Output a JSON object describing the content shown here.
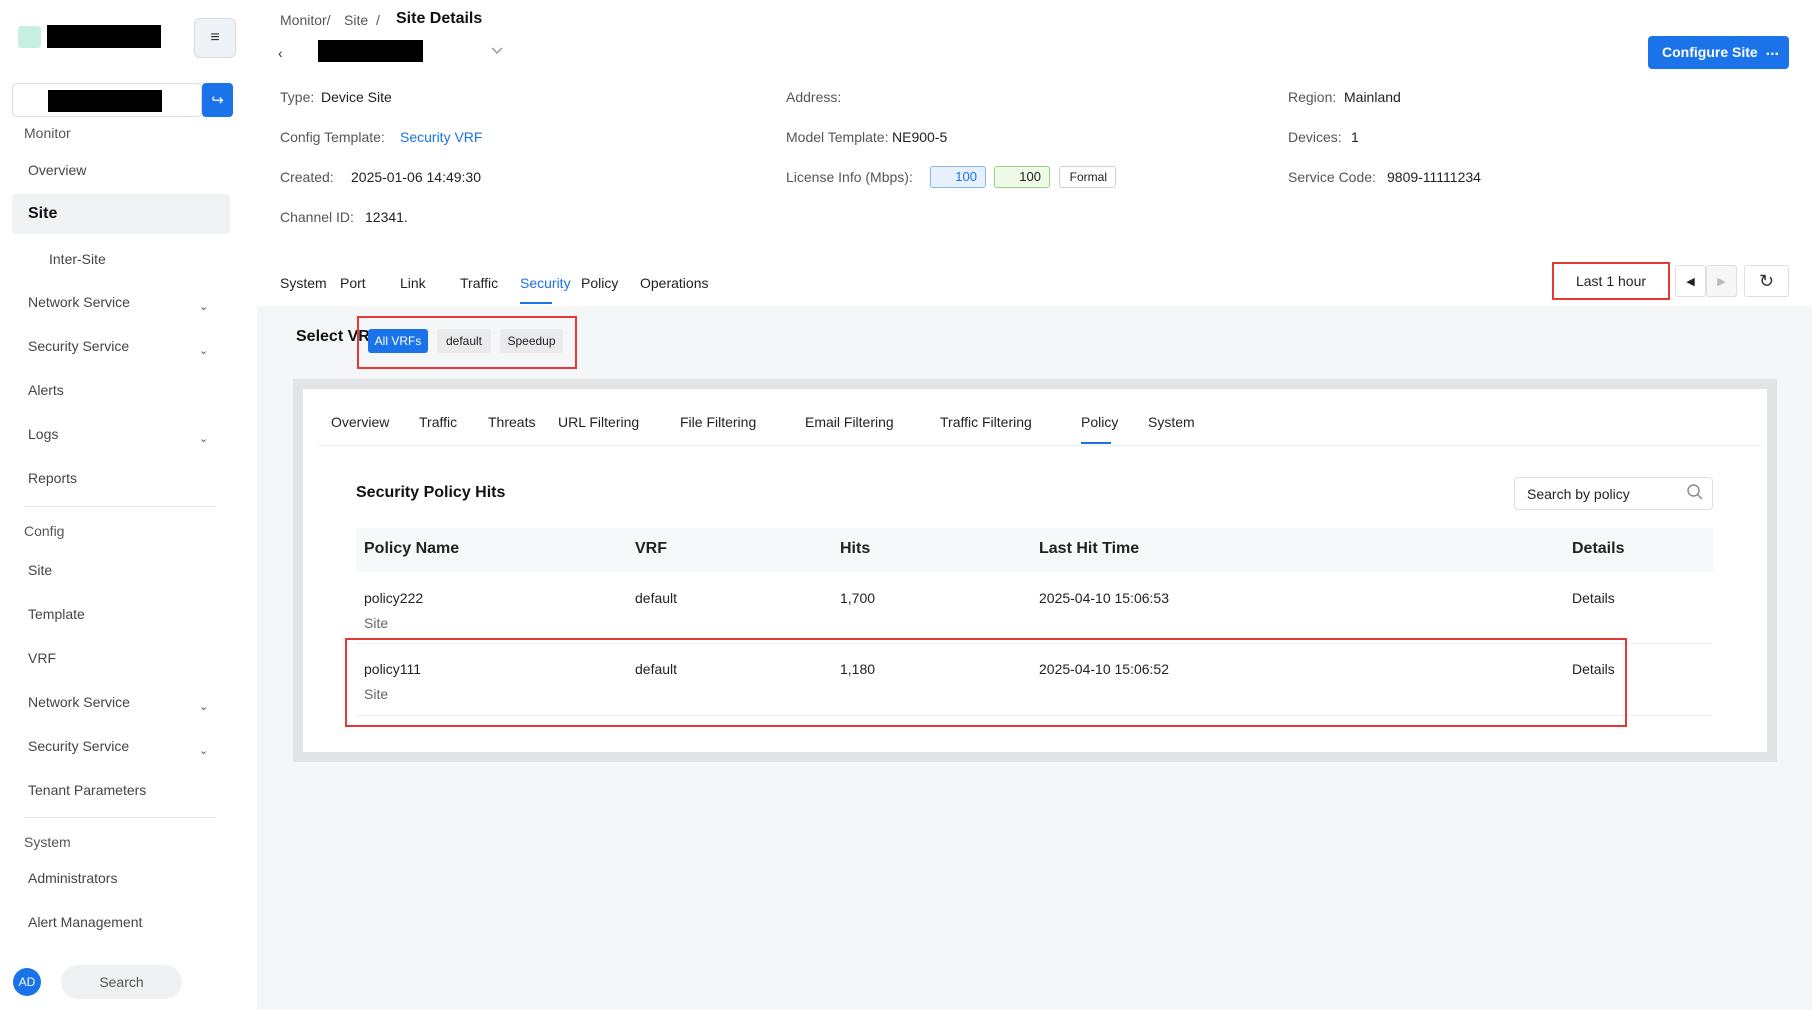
{
  "sidebar": {
    "menu_icon": "hamburger-icon",
    "tenant_go_icon": "switch-arrow-icon",
    "sections": {
      "monitor": "Monitor",
      "config": "Config",
      "system": "System"
    },
    "monitor_items": {
      "overview": "Overview",
      "site": "Site",
      "inter_site": "Inter-Site",
      "network_service": "Network Service",
      "security_service": "Security Service",
      "alerts": "Alerts",
      "logs": "Logs",
      "reports": "Reports"
    },
    "config_items": {
      "site": "Site",
      "template": "Template",
      "vrf": "VRF",
      "network_service": "Network Service",
      "security_service": "Security Service",
      "tenant_parameters": "Tenant Parameters"
    },
    "system_items": {
      "administrators": "Administrators",
      "alert_management": "Alert Management"
    },
    "avatar": "AD",
    "search": "Search"
  },
  "header": {
    "breadcrumb": [
      "Monitor/",
      "Site",
      "/"
    ],
    "current": "Site Details",
    "back": "‹",
    "configure": "Configure Site",
    "more": "..."
  },
  "info": {
    "type_label": "Type:",
    "type_value": "Device Site",
    "address_label": "Address:",
    "region_label": "Region:",
    "region_value": "Mainland",
    "config_template_label": "Config Template:",
    "config_template_value": "Security VRF",
    "model_template_label": "Model Template:",
    "model_template_value": "NE900-5",
    "devices_label": "Devices:",
    "devices_value": "1",
    "created_label": "Created:",
    "created_value": "2025-01-06 14:49:30",
    "license_label": "License Info (Mbps):",
    "license_values": [
      "100",
      "100",
      "Formal"
    ],
    "service_code_label": "Service Code:",
    "service_code_value": "9809-11111234",
    "channel_label": "Channel ID:",
    "channel_value": "12341."
  },
  "tabs": [
    "System",
    "Port",
    "Link",
    "Traffic",
    "Security",
    "Policy",
    "Operations"
  ],
  "time_range": "Last 1 hour",
  "select_vrf": {
    "label": "Select VR",
    "options": [
      "All VRFs",
      "default",
      "Speedup"
    ]
  },
  "sub_tabs": [
    "Overview",
    "Traffic",
    "Threats",
    "URL Filtering",
    "File Filtering",
    "Email Filtering",
    "Traffic Filtering",
    "Policy",
    "System"
  ],
  "policy_hits": {
    "title": "Security Policy Hits",
    "search_placeholder": "Search by policy",
    "columns": [
      "Policy Name",
      "VRF",
      "Hits",
      "Last Hit Time",
      "Details"
    ],
    "rows": [
      {
        "name": "policy222",
        "scope": "Site",
        "vrf": "default",
        "hits": "1,700",
        "last_hit": "2025-04-10 15:06:53",
        "details": "Details"
      },
      {
        "name": "policy111",
        "scope": "Site",
        "vrf": "default",
        "hits": "1,180",
        "last_hit": "2025-04-10 15:06:52",
        "details": "Details"
      }
    ]
  },
  "colors": {
    "accent": "#1a73e8",
    "highlight": "#e53935"
  }
}
